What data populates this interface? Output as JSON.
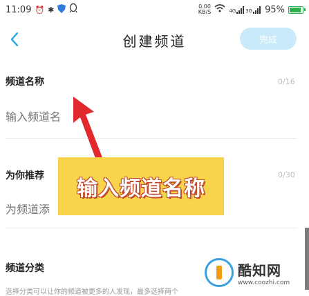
{
  "status_bar": {
    "time": "11:09",
    "net_speed_value": "0.00",
    "net_speed_unit": "KB/S",
    "signal1_label": "4G",
    "signal2_label": "3G",
    "battery_percent": "95%",
    "battery_level": 0.95,
    "icons": [
      "alarm-icon",
      "bluetooth-icon",
      "shield-app-icon",
      "qq-icon",
      "wifi-icon",
      "signal-icon",
      "battery-icon"
    ]
  },
  "header": {
    "title": "创建频道",
    "done_label": "完成"
  },
  "form": {
    "name": {
      "label": "频道名称",
      "count": "0/16",
      "placeholder": "输入频道名"
    },
    "recommend": {
      "label": "为你推荐",
      "count": "0/30",
      "placeholder": "为频道添"
    },
    "category": {
      "label": "频道分类",
      "hint": "选择分类可以让你的频道被更多的人发现，最多选择两个"
    }
  },
  "annotation": {
    "callout_text": "输入频道名称",
    "callout_color": "#f7d44c",
    "arrow_color": "#e0282d"
  },
  "watermark": {
    "name": "酷知网",
    "url": "www.coozhi.com"
  },
  "colors": {
    "accent": "#1ea7e1",
    "done_disabled": "#c9eafb"
  }
}
